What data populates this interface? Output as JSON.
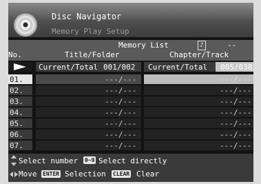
{
  "app": {
    "title": "Disc Navigator",
    "subtitle": "Memory Play Setup"
  },
  "list": {
    "title": "Memory List",
    "disc_type_icon": "music-note-icon",
    "disc_type_value": "--"
  },
  "columns": {
    "no": "No.",
    "title": "Title/Folder",
    "chapter": "Chapter/Track"
  },
  "current": {
    "indicator_icon": "play-arrow-icon",
    "title_label": "Current/Total",
    "title_value": "001/002",
    "chapter_label": "Current/Total",
    "chapter_value": "005/038"
  },
  "rows": [
    {
      "no": "01.",
      "title": "---/---",
      "chapter": "---/---",
      "selected": true
    },
    {
      "no": "02.",
      "title": "---/---",
      "chapter": "---/---"
    },
    {
      "no": "03.",
      "title": "---/---",
      "chapter": "---/---"
    },
    {
      "no": "04.",
      "title": "---/---",
      "chapter": "---/---"
    },
    {
      "no": "05.",
      "title": "---/---",
      "chapter": "---/---"
    },
    {
      "no": "06.",
      "title": "---/---",
      "chapter": "---/---"
    },
    {
      "no": "07.",
      "title": "---/---",
      "chapter": "---/---"
    }
  ],
  "help": {
    "line1_text": "Select number",
    "digit_key": "0~9",
    "line1_text2": "Select directly",
    "line2_text": "Move",
    "enter_key": "ENTER",
    "line2_text2": "Selection",
    "clear_key": "CLEAR",
    "line2_text3": "Clear"
  }
}
